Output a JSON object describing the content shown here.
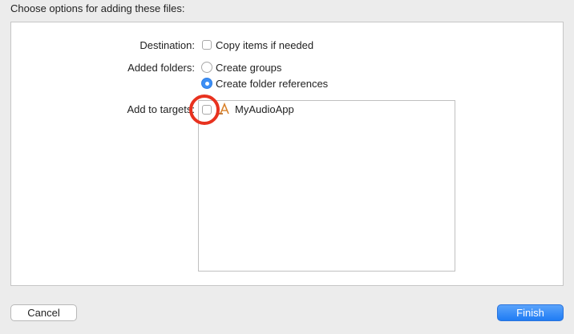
{
  "dialog": {
    "heading": "Choose options for adding these files:"
  },
  "destination": {
    "label": "Destination:",
    "copy_items_label": "Copy items if needed",
    "copy_items_checked": false
  },
  "added_folders": {
    "label": "Added folders:",
    "options": [
      {
        "label": "Create groups",
        "selected": false
      },
      {
        "label": "Create folder references",
        "selected": true
      }
    ]
  },
  "targets": {
    "label": "Add to targets:",
    "items": [
      {
        "name": "MyAudioApp",
        "checked": false,
        "icon": "app-target-icon"
      }
    ]
  },
  "annotation": {
    "highlight_color": "#e8321f"
  },
  "buttons": {
    "cancel_label": "Cancel",
    "finish_label": "Finish"
  },
  "colors": {
    "accent": "#1f7cf4",
    "background": "#ececec"
  }
}
